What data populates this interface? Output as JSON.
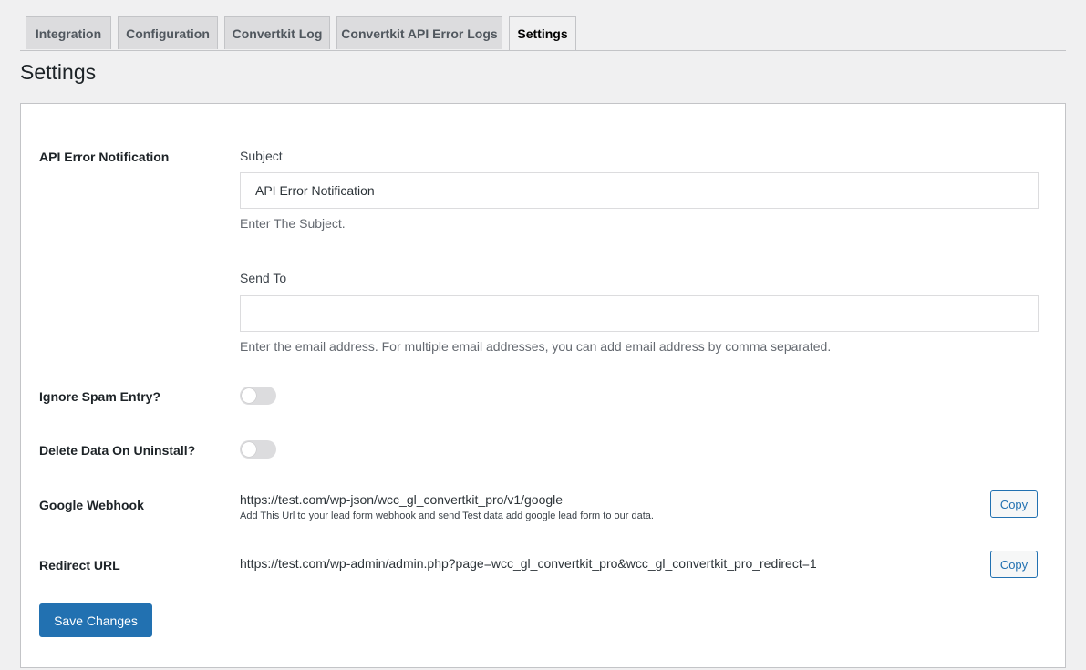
{
  "tabs": [
    {
      "label": "Integration"
    },
    {
      "label": "Configuration"
    },
    {
      "label": "Convertkit Log"
    },
    {
      "label": "Convertkit API Error Logs"
    },
    {
      "label": "Settings"
    }
  ],
  "page_title": "Settings",
  "api_error": {
    "label": "API Error Notification",
    "subject_label": "Subject",
    "subject_value": "API Error Notification",
    "subject_desc": "Enter The Subject.",
    "sendto_label": "Send To",
    "sendto_value": "",
    "sendto_desc": "Enter the email address. For multiple email addresses, you can add email address by comma separated."
  },
  "ignore_spam": {
    "label": "Ignore Spam Entry?",
    "enabled": false
  },
  "delete_data": {
    "label": "Delete Data On Uninstall?",
    "enabled": false
  },
  "google_webhook": {
    "label": "Google Webhook",
    "url": "https://test.com/wp-json/wcc_gl_convertkit_pro/v1/google",
    "desc": "Add This Url to your lead form webhook and send Test data add google lead form to our data.",
    "copy_label": "Copy"
  },
  "redirect_url": {
    "label": "Redirect URL",
    "url": "https://test.com/wp-admin/admin.php?page=wcc_gl_convertkit_pro&wcc_gl_convertkit_pro_redirect=1",
    "copy_label": "Copy"
  },
  "save_label": "Save Changes",
  "colors": {
    "primary": "#2271b1",
    "background": "#f0f0f1"
  }
}
